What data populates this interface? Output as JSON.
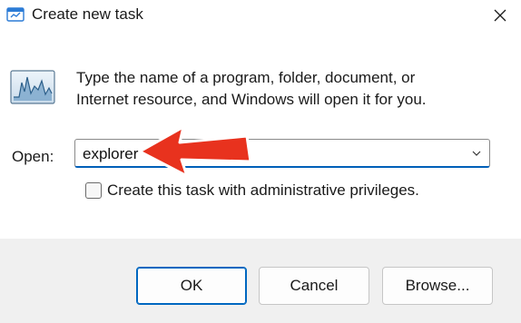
{
  "window": {
    "title": "Create new task",
    "app_icon": "run-icon",
    "close_icon": "close-icon"
  },
  "description": {
    "line1": "Type the name of a program, folder, document, or",
    "line2": "Internet resource, and Windows will open it for you.",
    "icon": "task-manager-icon"
  },
  "open_field": {
    "label": "Open:",
    "value": "explorer",
    "dropdown_icon": "chevron-down-icon"
  },
  "admin_checkbox": {
    "label": "Create this task with administrative privileges.",
    "checked": false
  },
  "buttons": {
    "ok": "OK",
    "cancel": "Cancel",
    "browse": "Browse..."
  },
  "colors": {
    "accent": "#005fb8",
    "annotation_arrow": "#e8321e",
    "footer_bg": "#f0f0f0"
  }
}
